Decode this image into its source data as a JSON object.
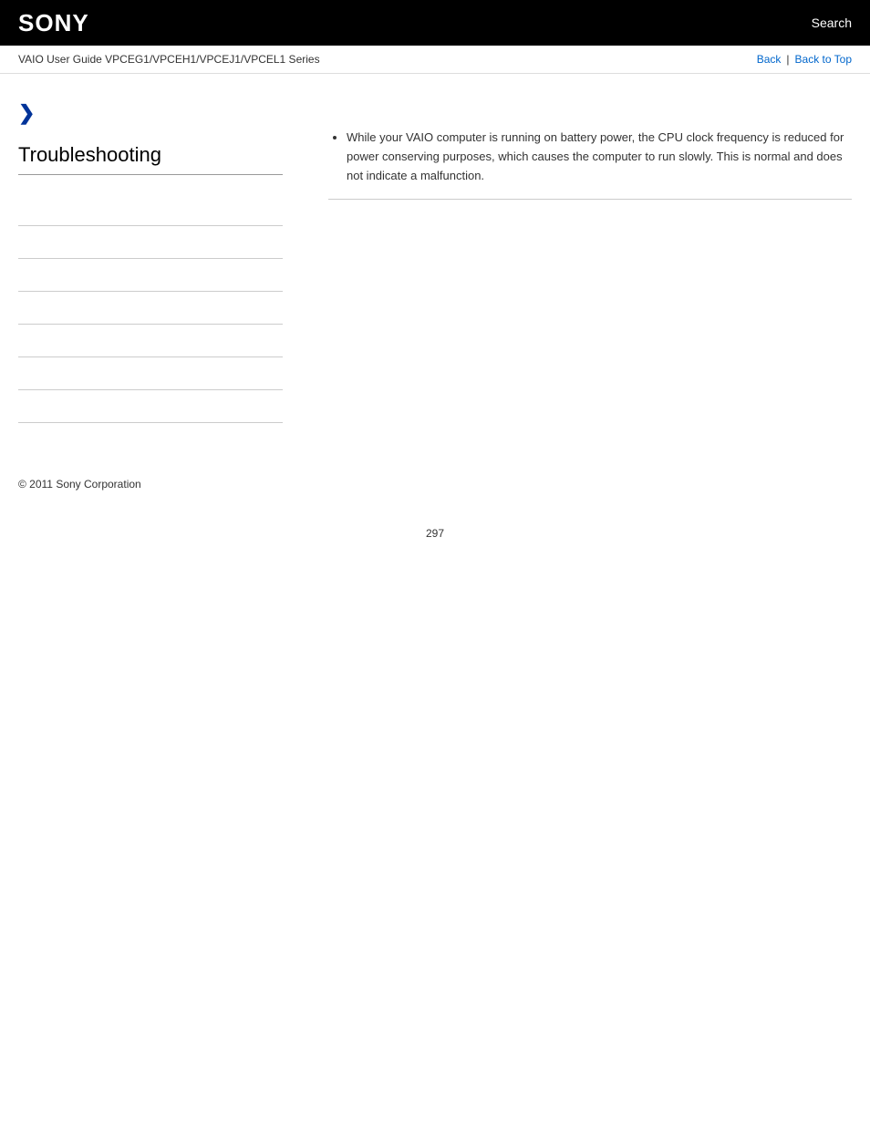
{
  "header": {
    "logo": "SONY",
    "search_label": "Search"
  },
  "breadcrumb": {
    "guide_title": "VAIO User Guide VPCEG1/VPCEH1/VPCEJ1/VPCEL1 Series",
    "back_label": "Back",
    "back_to_top_label": "Back to Top"
  },
  "sidebar": {
    "chevron": "❯",
    "section_title": "Troubleshooting",
    "links": [
      {
        "label": ""
      },
      {
        "label": ""
      },
      {
        "label": ""
      },
      {
        "label": ""
      },
      {
        "label": ""
      },
      {
        "label": ""
      },
      {
        "label": ""
      }
    ]
  },
  "content": {
    "bullet_point": "While your VAIO computer is running on battery power, the CPU clock frequency is reduced for power conserving purposes, which causes the computer to run slowly. This is normal and does not indicate a malfunction."
  },
  "footer": {
    "copyright": "© 2011 Sony Corporation"
  },
  "page": {
    "number": "297"
  }
}
